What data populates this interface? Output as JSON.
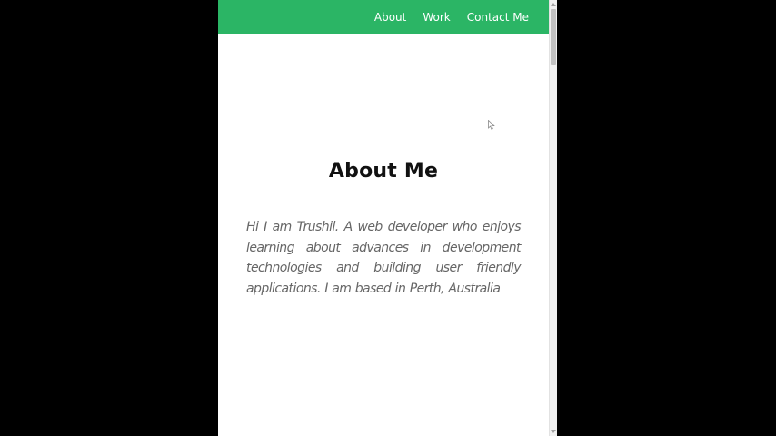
{
  "nav": {
    "links": [
      "About",
      "Work",
      "Contact Me"
    ],
    "background_color": "#2bb565"
  },
  "about": {
    "heading": "About Me",
    "intro": "Hi I am Trushil. A web developer who enjoys learning about advances in development technologies and building user friendly applications. I am based in Perth, Australia"
  },
  "scrollbar": {
    "position_fraction": 0.0
  },
  "icons": {
    "cursor": "mouse-pointer-icon",
    "scroll_up": "chevron-up-icon",
    "scroll_down": "chevron-down-icon"
  }
}
